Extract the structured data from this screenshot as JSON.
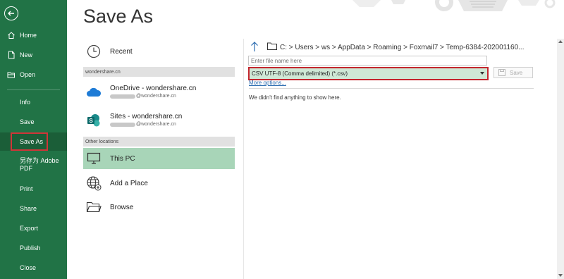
{
  "sidebar": {
    "items": [
      {
        "label": "Home"
      },
      {
        "label": "New"
      },
      {
        "label": "Open"
      },
      {
        "label": "Info"
      },
      {
        "label": "Save"
      },
      {
        "label": "Save As"
      },
      {
        "label": "另存为 Adobe PDF"
      },
      {
        "label": "Print"
      },
      {
        "label": "Share"
      },
      {
        "label": "Export"
      },
      {
        "label": "Publish"
      },
      {
        "label": "Close"
      }
    ],
    "active": "Save As",
    "colors": {
      "bg": "#217346",
      "active_bg": "#1b5e38",
      "highlight_border": "#d13438"
    }
  },
  "main": {
    "title": "Save As",
    "recent": {
      "label": "Recent"
    },
    "groups": [
      {
        "header": "wondershare.cn",
        "items": [
          {
            "name": "OneDrive - wondershare.cn",
            "account": "@wondershare.cn",
            "icon": "onedrive-cloud-icon"
          },
          {
            "name": "Sites - wondershare.cn",
            "account": "@wondershare.cn",
            "icon": "sharepoint-sites-icon"
          }
        ]
      },
      {
        "header": "Other locations",
        "items": [
          {
            "name": "This PC",
            "icon": "computer-icon",
            "selected": true
          },
          {
            "name": "Add a Place",
            "icon": "globe-add-icon"
          },
          {
            "name": "Browse",
            "icon": "folder-open-icon"
          }
        ]
      }
    ]
  },
  "save_panel": {
    "path": "C: > Users > ws > AppData > Roaming > Foxmail7 > Temp-6384-202001160...",
    "filename_placeholder": "Enter file name here",
    "filename_value": "",
    "file_type": "CSV UTF-8 (Comma delimited) (*.csv)",
    "save_label": "Save",
    "more_options": "More options...",
    "empty_message": "We didn't find anything to show here.",
    "colors": {
      "file_type_bg": "#cfe8d6",
      "file_type_border": "#c4262e",
      "this_pc_bg": "#a8d5b8"
    }
  }
}
